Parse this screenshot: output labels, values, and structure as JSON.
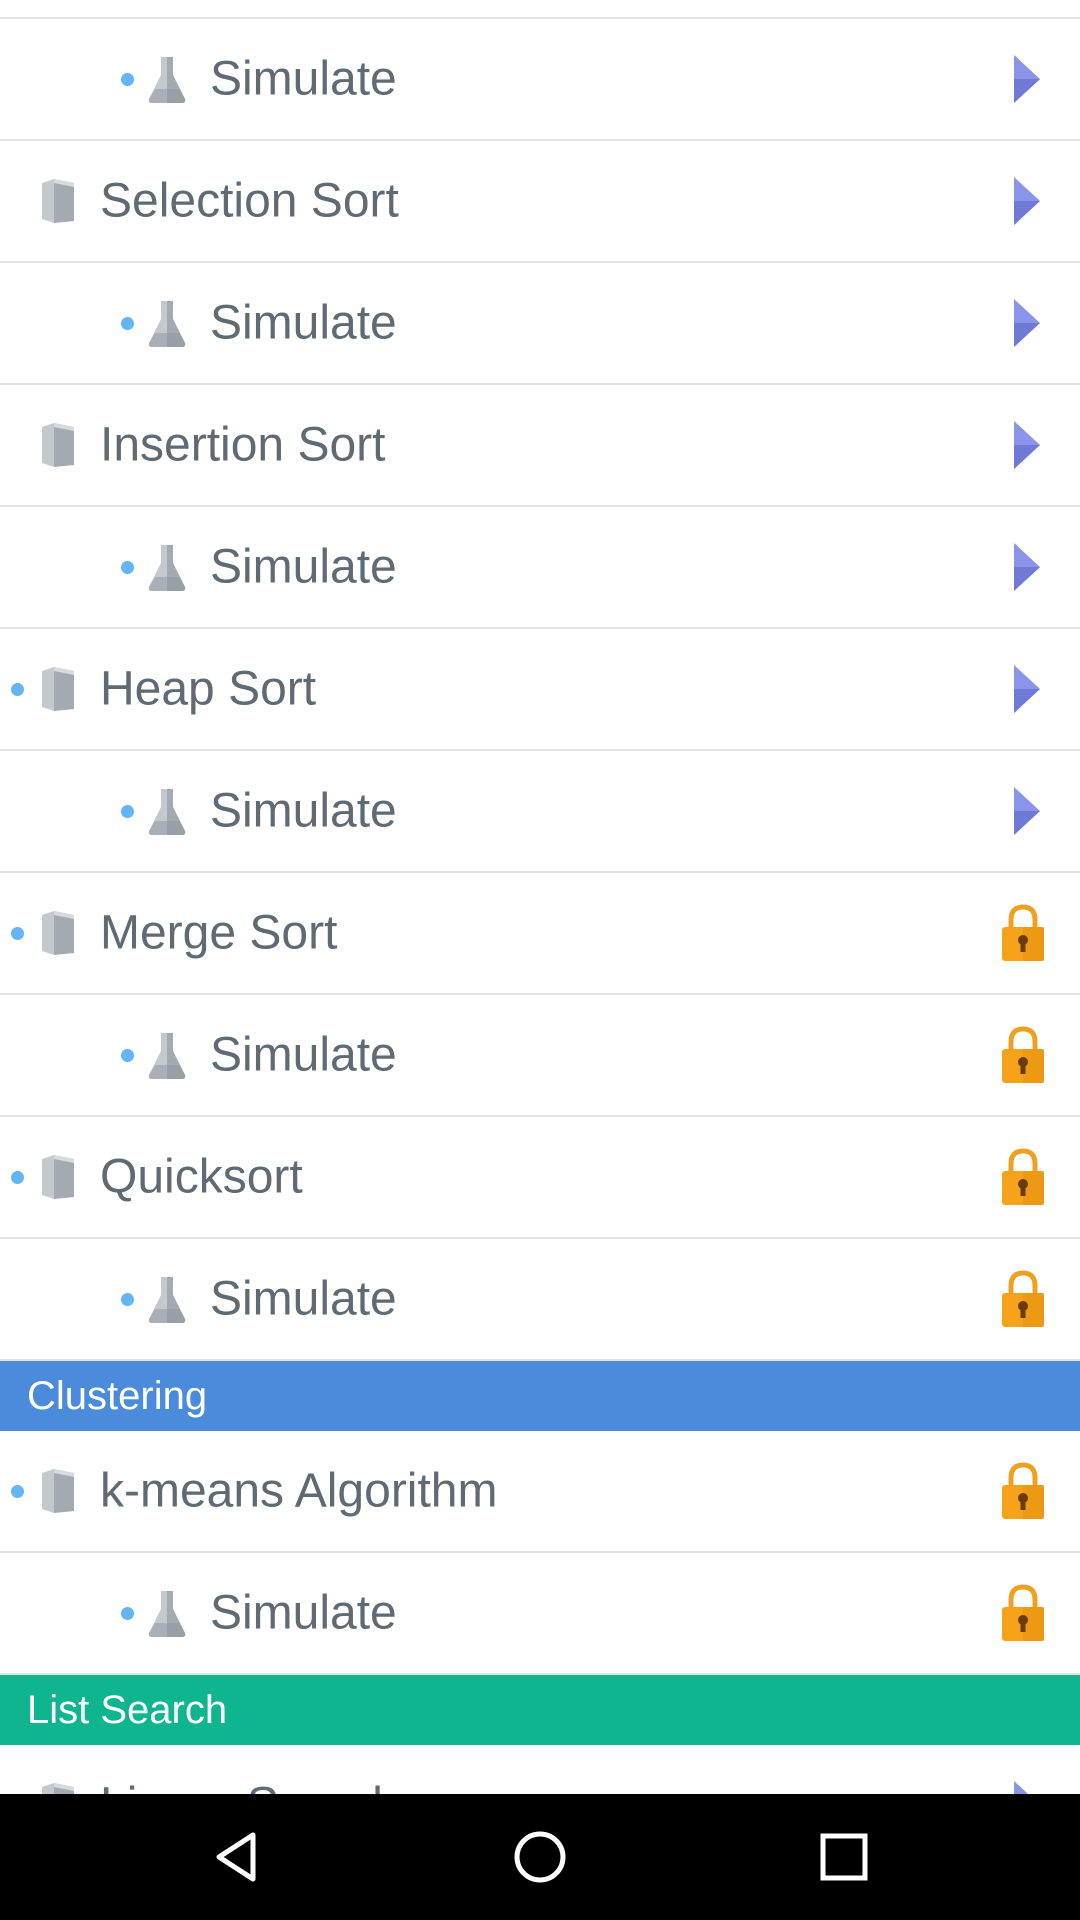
{
  "list": {
    "rows": [
      {
        "kind": "sub",
        "label": "Simulate",
        "dot": true,
        "action": "play-arrow-icon"
      },
      {
        "kind": "topic",
        "label": "Selection Sort",
        "dot": false,
        "action": "play-arrow-icon"
      },
      {
        "kind": "sub",
        "label": "Simulate",
        "dot": true,
        "action": "play-arrow-icon"
      },
      {
        "kind": "topic",
        "label": "Insertion Sort",
        "dot": false,
        "action": "play-arrow-icon"
      },
      {
        "kind": "sub",
        "label": "Simulate",
        "dot": true,
        "action": "play-arrow-icon"
      },
      {
        "kind": "topic",
        "label": "Heap Sort",
        "dot": true,
        "action": "play-arrow-icon"
      },
      {
        "kind": "sub",
        "label": "Simulate",
        "dot": true,
        "action": "play-arrow-icon"
      },
      {
        "kind": "topic",
        "label": "Merge Sort",
        "dot": true,
        "action": "lock-icon"
      },
      {
        "kind": "sub",
        "label": "Simulate",
        "dot": true,
        "action": "lock-icon"
      },
      {
        "kind": "topic",
        "label": "Quicksort",
        "dot": true,
        "action": "lock-icon"
      },
      {
        "kind": "sub",
        "label": "Simulate",
        "dot": true,
        "action": "lock-icon"
      },
      {
        "kind": "section",
        "label": "Clustering",
        "color": "#4a8cdb"
      },
      {
        "kind": "topic",
        "label": "k-means Algorithm",
        "dot": true,
        "action": "lock-icon"
      },
      {
        "kind": "sub",
        "label": "Simulate",
        "dot": true,
        "action": "lock-icon"
      },
      {
        "kind": "section",
        "label": "List Search",
        "color": "#0fb58f"
      },
      {
        "kind": "topic",
        "label": "Linear Search",
        "dot": true,
        "action": "play-arrow-icon"
      }
    ]
  },
  "colors": {
    "play_arrow": "#8a94e8",
    "lock": "#f7a21b",
    "dot": "#64b5f6",
    "text": "#606a73",
    "section_clustering": "#4a8cdb",
    "section_list_search": "#0fb58f"
  },
  "navbar": {
    "back": "back-triangle-icon",
    "home": "home-circle-icon",
    "recents": "recents-square-icon"
  }
}
